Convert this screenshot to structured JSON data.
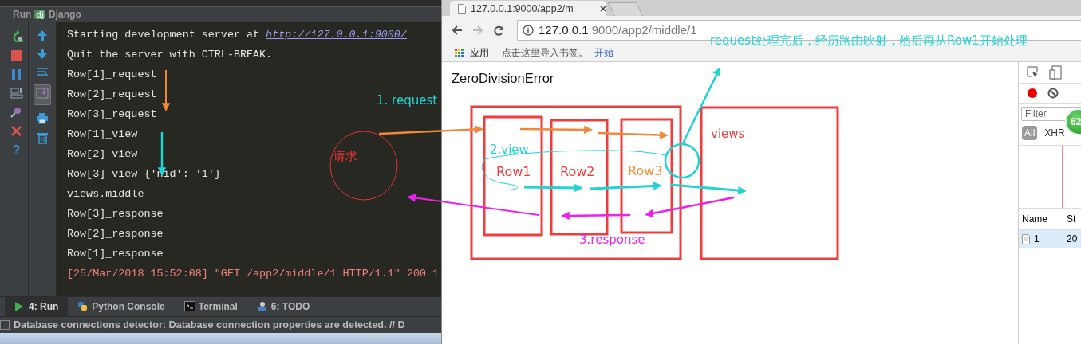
{
  "ide": {
    "run_header": {
      "label": "Run",
      "icon_text": "dj",
      "config": "Django"
    },
    "help_glyph": "?",
    "console_lines": [
      {
        "kind": "link",
        "text": "Starting development server at ",
        "link": "http://127.0.0.1:9000/"
      },
      {
        "kind": "plain",
        "text": "Quit the server with CTRL-BREAK."
      },
      {
        "kind": "plain",
        "text": "Row[1]_request"
      },
      {
        "kind": "plain",
        "text": "Row[2]_request"
      },
      {
        "kind": "plain",
        "text": "Row[3]_request"
      },
      {
        "kind": "plain",
        "text": "Row[1]_view"
      },
      {
        "kind": "plain",
        "text": "Row[2]_view"
      },
      {
        "kind": "plain",
        "text": "Row[3]_view {'nid': '1'}"
      },
      {
        "kind": "plain",
        "text": "views.middle"
      },
      {
        "kind": "plain",
        "text": "Row[3]_response"
      },
      {
        "kind": "plain",
        "text": "Row[2]_response"
      },
      {
        "kind": "plain",
        "text": "Row[1]_response"
      },
      {
        "kind": "log",
        "text": "[25/Mar/2018 15:52:08] \"GET /app2/middle/1 HTTP/1.1\" 200 1"
      }
    ],
    "tool_tabs": [
      {
        "kind": "run",
        "mnemonic": "4",
        "label": ": Run",
        "selected": true
      },
      {
        "kind": "python",
        "label": "Python Console",
        "selected": false
      },
      {
        "kind": "terminal",
        "label": "Terminal",
        "selected": false
      },
      {
        "kind": "todo",
        "mnemonic": "6",
        "label": ": TODO",
        "selected": false
      }
    ],
    "status_bar": "Database connections detector: Database connection properties are detected. // D"
  },
  "browser": {
    "tab_title": "127.0.0.1:9000/app2/m",
    "address": {
      "host": "127.0.0.1",
      "rest": ":9000/app2/middle/1"
    },
    "bookmarks": [
      {
        "kind": "apps",
        "label": "应用"
      },
      {
        "kind": "hint",
        "label": "点击这里导入书签。"
      },
      {
        "kind": "link",
        "label": "开始"
      }
    ],
    "page_heading": "ZeroDivisionError",
    "devtools": {
      "filter_placeholder": "Filter",
      "types": [
        {
          "label": "All",
          "selected": true
        },
        {
          "label": "XHR",
          "selected": false
        }
      ],
      "columns": [
        "Name",
        "St"
      ],
      "rows": [
        {
          "name": "1",
          "status": "20",
          "selected": true
        }
      ],
      "badge": "62"
    }
  },
  "annotations": [
    {
      "text": "request处理完后，经历路由映射，然后再从Row1开始处理",
      "color": "#22d3d3"
    },
    {
      "text": "1. request",
      "color": "#22d3d3"
    },
    {
      "text": "请求",
      "color": "#e53333"
    },
    {
      "text": "2.view",
      "color": "#22d3d3"
    },
    {
      "text": "Row1",
      "color": "#f03c3c"
    },
    {
      "text": "Row2",
      "color": "#f03c3c"
    },
    {
      "text": "Row3",
      "color": "#f59036"
    },
    {
      "text": "views",
      "color": "#f03c3c"
    },
    {
      "text": "3.response",
      "color": "#ee22ee"
    }
  ]
}
